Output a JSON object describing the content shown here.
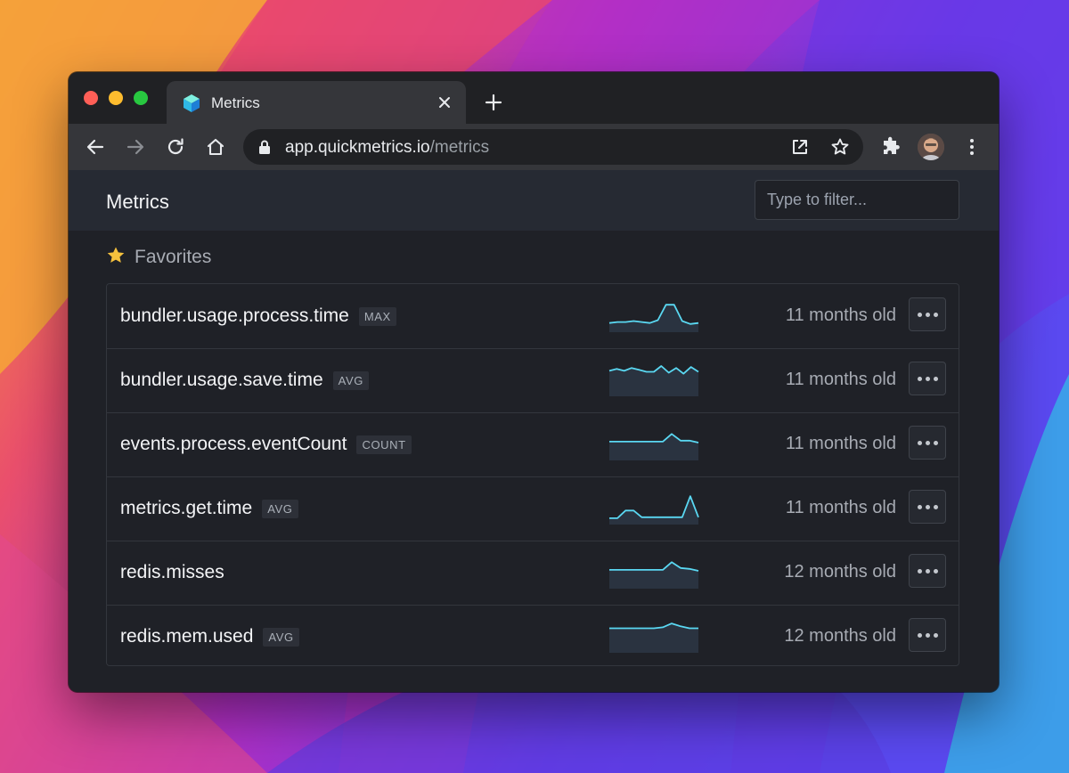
{
  "browser": {
    "tab_title": "Metrics",
    "url_host": "app.quickmetrics.io",
    "url_path": "/metrics"
  },
  "app": {
    "page_title": "Metrics",
    "filter_placeholder": "Type to filter..."
  },
  "favorites": {
    "heading": "Favorites",
    "metrics": [
      {
        "name": "bundler.usage.process.time",
        "aggregation": "MAX",
        "age": "11 months old",
        "spark": [
          4,
          5,
          5,
          6,
          5,
          4,
          7,
          23,
          23,
          6,
          3,
          4
        ]
      },
      {
        "name": "bundler.usage.save.time",
        "aggregation": "AVG",
        "age": "11 months old",
        "spark": [
          21,
          23,
          21,
          24,
          22,
          20,
          20,
          26,
          19,
          24,
          18,
          25,
          20
        ]
      },
      {
        "name": "events.process.eventCount",
        "aggregation": "COUNT",
        "age": "11 months old",
        "spark": [
          14,
          14,
          14,
          14,
          14,
          14,
          14,
          22,
          15,
          15,
          13
        ]
      },
      {
        "name": "metrics.get.time",
        "aggregation": "AVG",
        "age": "11 months old",
        "spark": [
          1,
          1,
          9,
          9,
          2,
          2,
          2,
          2,
          2,
          2,
          24,
          2
        ]
      },
      {
        "name": "redis.misses",
        "aggregation": "",
        "age": "12 months old",
        "spark": [
          14,
          14,
          14,
          14,
          14,
          14,
          14,
          22,
          16,
          15,
          13
        ]
      },
      {
        "name": "redis.mem.used",
        "aggregation": "AVG",
        "age": "12 months old",
        "spark": [
          20,
          20,
          20,
          20,
          20,
          20,
          21,
          25,
          22,
          20,
          20
        ]
      }
    ]
  },
  "icons": {
    "favicon": "quickmetrics-logo-icon",
    "tab_close": "close-icon",
    "new_tab": "plus-icon",
    "back": "arrow-left-icon",
    "forward": "arrow-right-icon",
    "reload": "reload-icon",
    "home": "home-icon",
    "lock": "lock-icon",
    "open_in": "open-external-icon",
    "bookmark": "star-outline-icon",
    "extensions": "puzzle-icon",
    "menu": "kebab-menu-icon",
    "favorite": "star-filled-icon",
    "more": "ellipsis-icon"
  },
  "colors": {
    "sparkline_line": "#5ad8f2",
    "sparkline_fill": "#2a3340",
    "favorite_star": "#f5c13d"
  }
}
